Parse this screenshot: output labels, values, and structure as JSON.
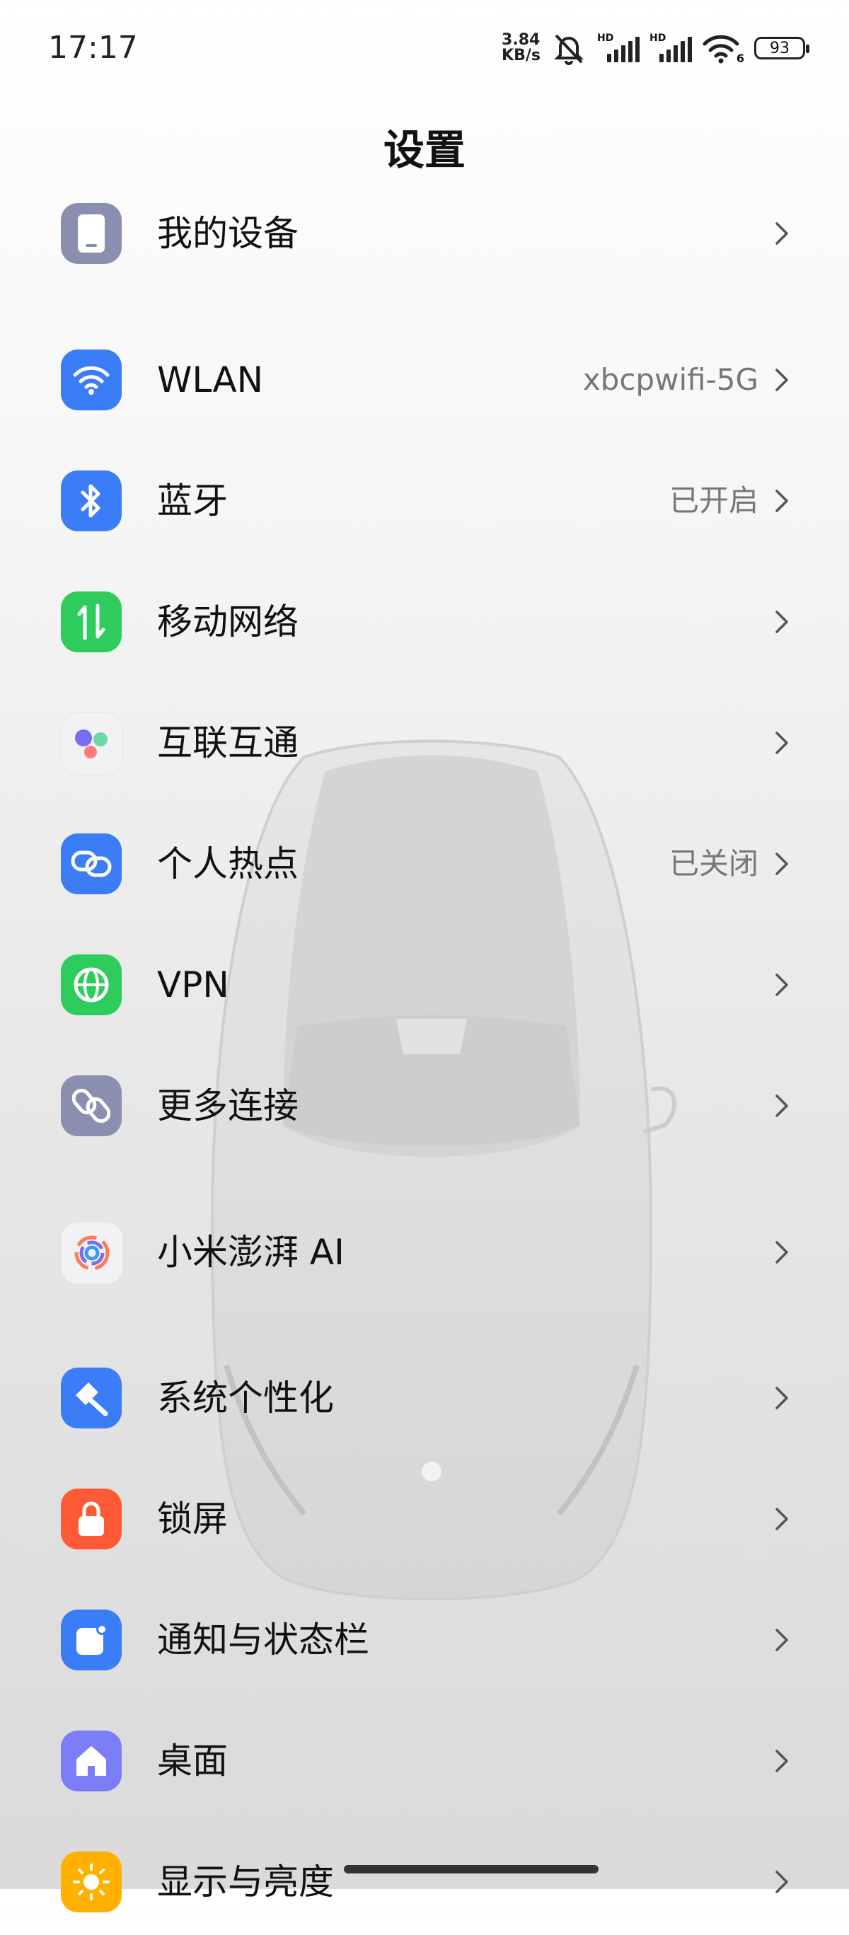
{
  "status_bar": {
    "time": "17:17",
    "net_speed_value": "3.84",
    "net_speed_unit": "KB/s",
    "sim1_tag": "HD",
    "sim2_tag": "HD",
    "wifi_sub": "6",
    "battery": "93"
  },
  "header": {
    "title": "设置"
  },
  "rows": [
    {
      "label": "我的设备",
      "value": "",
      "icon": "phone-icon",
      "color": "#8a8fb0"
    },
    {
      "label": "WLAN",
      "value": "xbcpwifi-5G",
      "icon": "wifi-icon",
      "color": "#3b7df6"
    },
    {
      "label": "蓝牙",
      "value": "已开启",
      "icon": "bluetooth-icon",
      "color": "#3b7df6"
    },
    {
      "label": "移动网络",
      "value": "",
      "icon": "mobile-data-icon",
      "color": "#2ecc5c"
    },
    {
      "label": "互联互通",
      "value": "",
      "icon": "interconnect-icon",
      "color": "#f2f2f4"
    },
    {
      "label": "个人热点",
      "value": "已关闭",
      "icon": "hotspot-icon",
      "color": "#3b7df6"
    },
    {
      "label": "VPN",
      "value": "",
      "icon": "globe-icon",
      "color": "#2ecc5c"
    },
    {
      "label": "更多连接",
      "value": "",
      "icon": "link-icon",
      "color": "#8a8fb0"
    },
    {
      "label": "小米澎湃 AI",
      "value": "",
      "icon": "ai-icon",
      "color": "#f2f2f4"
    },
    {
      "label": "系统个性化",
      "value": "",
      "icon": "paint-icon",
      "color": "#3b7df6"
    },
    {
      "label": "锁屏",
      "value": "",
      "icon": "lock-icon",
      "color": "#ff5a36"
    },
    {
      "label": "通知与状态栏",
      "value": "",
      "icon": "notification-icon",
      "color": "#3b7df6"
    },
    {
      "label": "桌面",
      "value": "",
      "icon": "home-icon",
      "color": "#7b7ef6"
    },
    {
      "label": "显示与亮度",
      "value": "",
      "icon": "sun-icon",
      "color": "#ffb000"
    }
  ]
}
